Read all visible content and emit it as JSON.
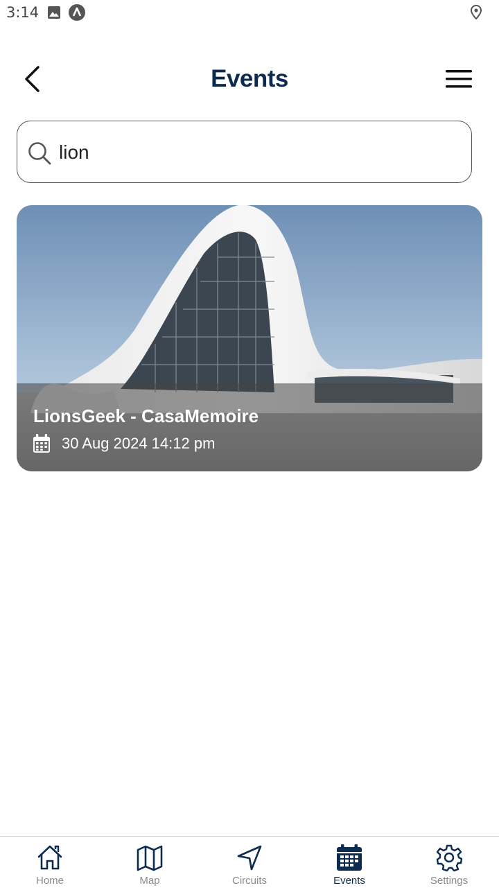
{
  "status_bar": {
    "time": "3:14",
    "icons": [
      "image-icon",
      "app-a-icon",
      "location-pin-icon"
    ]
  },
  "header": {
    "title": "Events",
    "back_icon": "chevron-left-icon",
    "menu_icon": "hamburger-menu-icon"
  },
  "search": {
    "value": "lion",
    "icon": "search-icon"
  },
  "events": [
    {
      "title": "LionsGeek - CasaMemoire",
      "date": "30 Aug 2024 14:12 pm",
      "date_icon": "calendar-icon"
    }
  ],
  "bottom_nav": {
    "items": [
      {
        "label": "Home",
        "icon": "home-icon",
        "active": false
      },
      {
        "label": "Map",
        "icon": "map-icon",
        "active": false
      },
      {
        "label": "Circuits",
        "icon": "navigation-arrow-icon",
        "active": false
      },
      {
        "label": "Events",
        "icon": "calendar-icon",
        "active": true
      },
      {
        "label": "Settings",
        "icon": "gear-icon",
        "active": false
      }
    ]
  },
  "colors": {
    "primary": "#0d2b4e",
    "inactive": "#8a8a8a"
  }
}
